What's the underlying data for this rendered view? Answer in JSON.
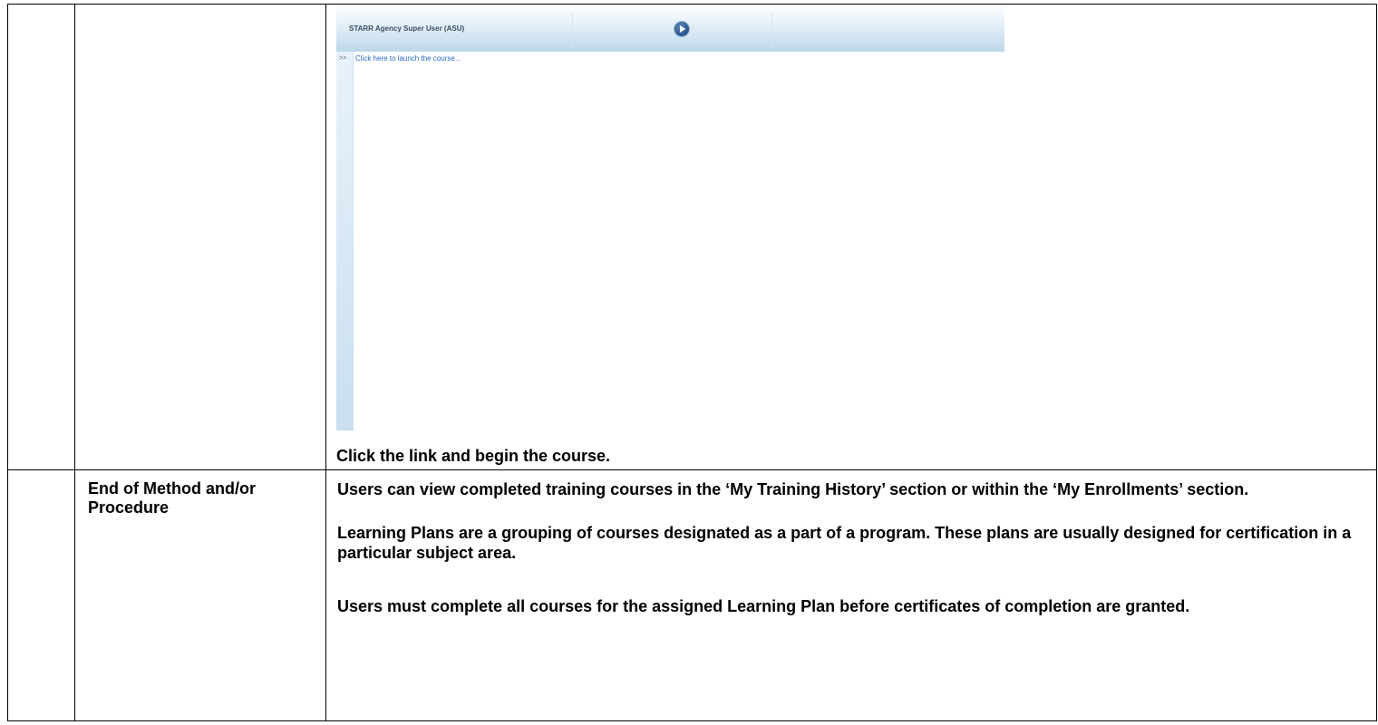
{
  "screenshot": {
    "user_label": "STARR Agency Super User (ASU)",
    "nav_marker": ">>",
    "launch_link": "Click here to launch the course..."
  },
  "caption": "Click the link and begin the course.",
  "end_section": {
    "label": "End of Method and/or Procedure",
    "paragraphs": [
      "Users can view completed training courses in the ‘My Training History’ section or within the ‘My Enrollments’ section.",
      "Learning Plans are a grouping of courses designated as a part of a program. These plans are usually designed for certification in a particular subject area.",
      "Users must complete all courses for the assigned Learning Plan before certificates of completion are granted."
    ]
  },
  "colors": {
    "header_gradient_end": "#bcd7ea",
    "link": "#2b67c2",
    "play_button": "#1f4d86"
  },
  "icons": [
    "play-icon"
  ]
}
